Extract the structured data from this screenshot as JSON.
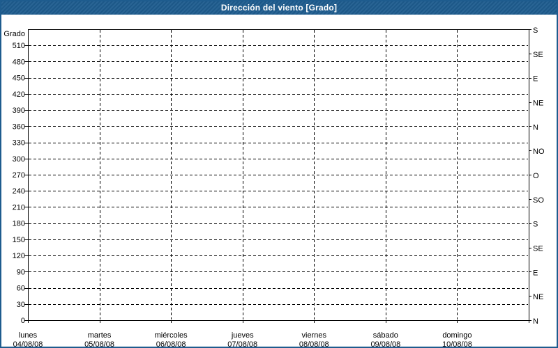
{
  "window": {
    "title": "Dirección del viento [Grado]"
  },
  "colors": {
    "titlebar": "#1e5c8e",
    "window_border": "#1e5c8e",
    "background": "#ffffff",
    "axis": "#000000",
    "grid": "#000000",
    "text": "#000000",
    "title_text": "#ffffff"
  },
  "chart_data": {
    "type": "line",
    "title": "Dirección del viento [Grado]",
    "ylabel": "Grado",
    "ylim": [
      0,
      540
    ],
    "y_tick_step": 30,
    "y_ticks": [
      0,
      30,
      60,
      90,
      120,
      150,
      180,
      210,
      240,
      270,
      300,
      330,
      360,
      390,
      420,
      450,
      480,
      510
    ],
    "right_axis_ticks": [
      {
        "deg": 0,
        "label": "N"
      },
      {
        "deg": 45,
        "label": "NE"
      },
      {
        "deg": 90,
        "label": "E"
      },
      {
        "deg": 135,
        "label": "SE"
      },
      {
        "deg": 180,
        "label": "S"
      },
      {
        "deg": 225,
        "label": "SO"
      },
      {
        "deg": 270,
        "label": "O"
      },
      {
        "deg": 315,
        "label": "NO"
      },
      {
        "deg": 360,
        "label": "N"
      },
      {
        "deg": 405,
        "label": "NE"
      },
      {
        "deg": 450,
        "label": "E"
      },
      {
        "deg": 495,
        "label": "SE"
      },
      {
        "deg": 540,
        "label": "S"
      }
    ],
    "x_categories": [
      {
        "weekday": "lunes",
        "date": "04/08/08"
      },
      {
        "weekday": "martes",
        "date": "05/08/08"
      },
      {
        "weekday": "miércoles",
        "date": "06/08/08"
      },
      {
        "weekday": "jueves",
        "date": "07/08/08"
      },
      {
        "weekday": "viernes",
        "date": "08/08/08"
      },
      {
        "weekday": "sábado",
        "date": "09/08/08"
      },
      {
        "weekday": "domingo",
        "date": "10/08/08"
      }
    ],
    "series": [],
    "grid": "dashed",
    "legend": "none"
  }
}
